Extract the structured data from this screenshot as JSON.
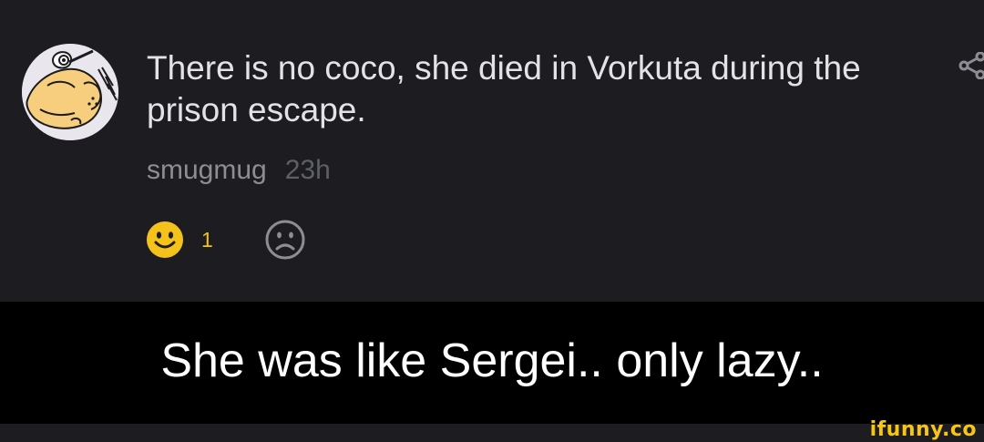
{
  "comment": {
    "avatar_icon": "cartoon-character-avatar",
    "text": "There is no coco, she died in Vorkuta during the prison escape.",
    "username": "smugmug",
    "timestamp": "23h",
    "like_icon": "smiley-face-icon",
    "like_count": "1",
    "dislike_icon": "sad-face-icon",
    "share_icon": "share-icon",
    "accent_color": "#f4c21a"
  },
  "caption": {
    "text": "She was like Sergei.. only lazy.."
  },
  "watermark": {
    "text": "ifunny.co"
  }
}
